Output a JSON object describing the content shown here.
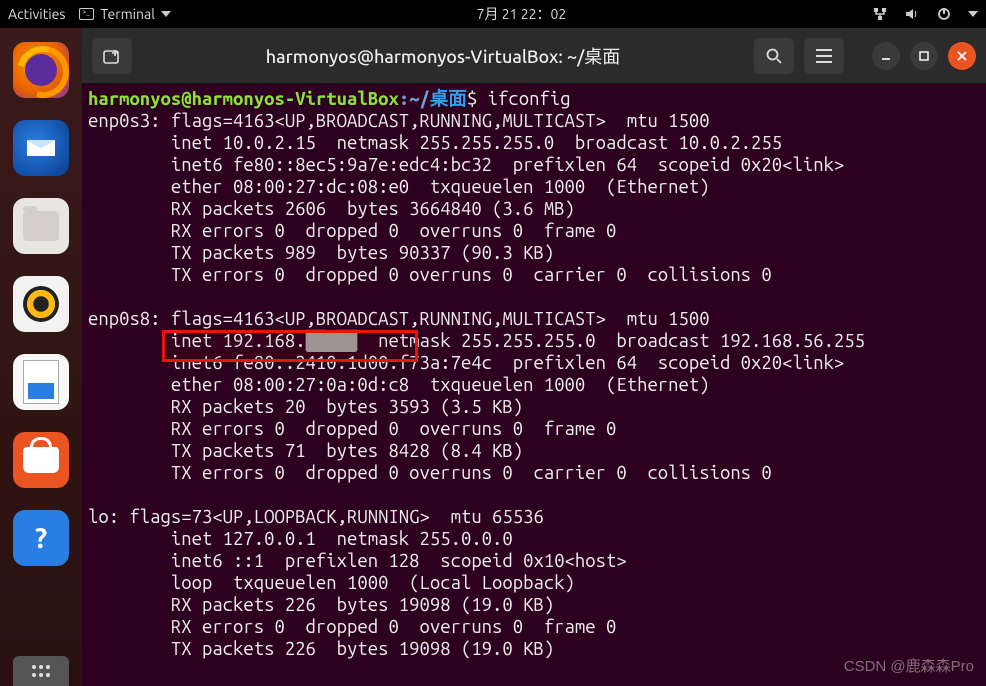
{
  "topbar": {
    "activities": "Activities",
    "terminal_label": "Terminal",
    "clock": "7月 21  22：02"
  },
  "window": {
    "title": "harmonyos@harmonyos-VirtualBox: ~/桌面"
  },
  "prompt": {
    "user_host": "harmonyos@harmonyos-VirtualBox",
    "sep": ":",
    "path_prefix": "~/",
    "path_cn": "桌面",
    "dollar": "$ ",
    "command": "ifconfig"
  },
  "ifconfig": {
    "enp0s3": {
      "l1": "enp0s3: flags=4163<UP,BROADCAST,RUNNING,MULTICAST>  mtu 1500",
      "l2": "        inet 10.0.2.15  netmask 255.255.255.0  broadcast 10.0.2.255",
      "l3": "        inet6 fe80::8ec5:9a7e:edc4:bc32  prefixlen 64  scopeid 0x20<link>",
      "l4": "        ether 08:00:27:dc:08:e0  txqueuelen 1000  (Ethernet)",
      "l5": "        RX packets 2606  bytes 3664840 (3.6 MB)",
      "l6": "        RX errors 0  dropped 0  overruns 0  frame 0",
      "l7": "        TX packets 989  bytes 90337 (90.3 KB)",
      "l8": "        TX errors 0  dropped 0 overruns 0  carrier 0  collisions 0"
    },
    "enp0s8": {
      "l1": "enp0s8: flags=4163<UP,BROADCAST,RUNNING,MULTICAST>  mtu 1500",
      "l2a": "        inet 192.168.",
      "l2_redact": "██.██",
      "l2b": "  netmask 255.255.255.0  broadcast 192.168.56.255",
      "l3": "        inet6 fe80::2410:1d00:f73a:7e4c  prefixlen 64  scopeid 0x20<link>",
      "l4": "        ether 08:00:27:0a:0d:c8  txqueuelen 1000  (Ethernet)",
      "l5": "        RX packets 20  bytes 3593 (3.5 KB)",
      "l6": "        RX errors 0  dropped 0  overruns 0  frame 0",
      "l7": "        TX packets 71  bytes 8428 (8.4 KB)",
      "l8": "        TX errors 0  dropped 0 overruns 0  carrier 0  collisions 0"
    },
    "lo": {
      "l1": "lo: flags=73<UP,LOOPBACK,RUNNING>  mtu 65536",
      "l2": "        inet 127.0.0.1  netmask 255.0.0.0",
      "l3": "        inet6 ::1  prefixlen 128  scopeid 0x10<host>",
      "l4": "        loop  txqueuelen 1000  (Local Loopback)",
      "l5": "        RX packets 226  bytes 19098 (19.0 KB)",
      "l6": "        RX errors 0  dropped 0  overruns 0  frame 0",
      "l7": "        TX packets 226  bytes 19098 (19.0 KB)"
    }
  },
  "watermark": "CSDN @鹿森森Pro"
}
